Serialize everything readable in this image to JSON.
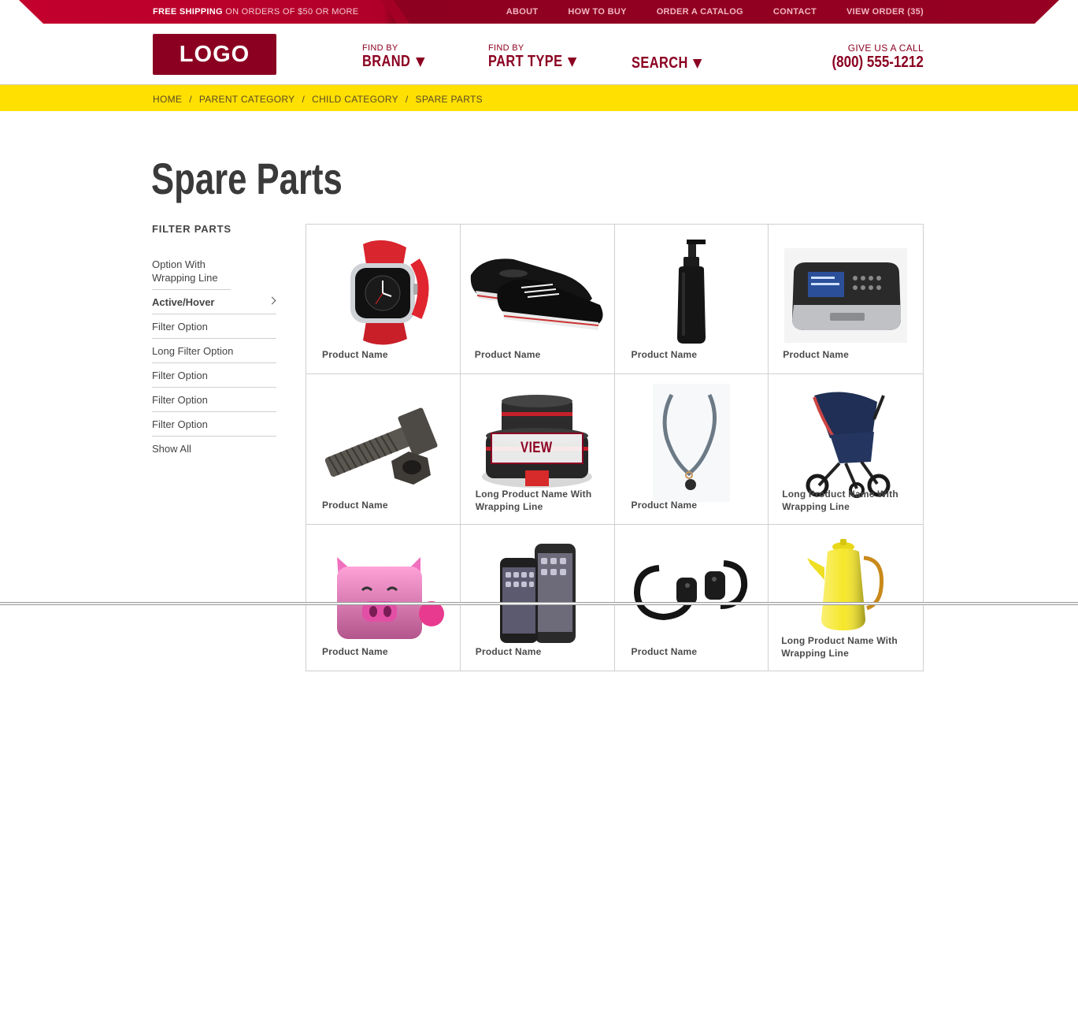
{
  "topbar": {
    "shipping_bold": "FREE SHIPPING",
    "shipping_rest": " ON ORDERS OF $50 OR MORE",
    "nav": [
      "ABOUT",
      "HOW TO BUY",
      "ORDER A CATALOG",
      "CONTACT",
      "VIEW ORDER (35)"
    ]
  },
  "header": {
    "logo": "LOGO",
    "brand_small": "FIND BY",
    "brand_big": "BRAND",
    "part_small": "FIND BY",
    "part_big": "PART TYPE",
    "search_big": "SEARCH",
    "call_small": "GIVE US A CALL",
    "call_big": "(800) 555-1212"
  },
  "breadcrumb": [
    "HOME",
    "PARENT CATEGORY",
    "CHILD CATEGORY",
    "SPARE PARTS"
  ],
  "page_title": "Spare Parts",
  "sidebar": {
    "heading": "FILTER PARTS",
    "items": [
      "Option With Wrapping Line",
      "Active/Hover",
      "Filter Option",
      "Long Filter Option",
      "Filter Option",
      "Filter Option",
      "Filter Option",
      "Show All"
    ]
  },
  "products": [
    {
      "name": "Product Name",
      "icon": "watch-icon"
    },
    {
      "name": "Product Name",
      "icon": "sneakers-icon"
    },
    {
      "name": "Product Name",
      "icon": "pump-bottle-icon"
    },
    {
      "name": "Product Name",
      "icon": "device-icon"
    },
    {
      "name": "Product Name",
      "icon": "bolt-nut-icon"
    },
    {
      "name": "Long Product Name With Wrapping Line",
      "icon": "cookware-icon"
    },
    {
      "name": "Product Name",
      "icon": "necklace-icon"
    },
    {
      "name": "Long Product Name With Wrapping Line",
      "icon": "stroller-icon"
    },
    {
      "name": "Product Name",
      "icon": "pig-toy-icon"
    },
    {
      "name": "Product Name",
      "icon": "phones-icon"
    },
    {
      "name": "Product Name",
      "icon": "controllers-icon"
    },
    {
      "name": "Long Product Name With Wrapping Line",
      "icon": "kettle-icon"
    }
  ],
  "view_button": "VIEW",
  "colors": {
    "brand": "#8b0021",
    "topbar": "#b8002b",
    "breadcrumb_bg": "#ffe000"
  }
}
